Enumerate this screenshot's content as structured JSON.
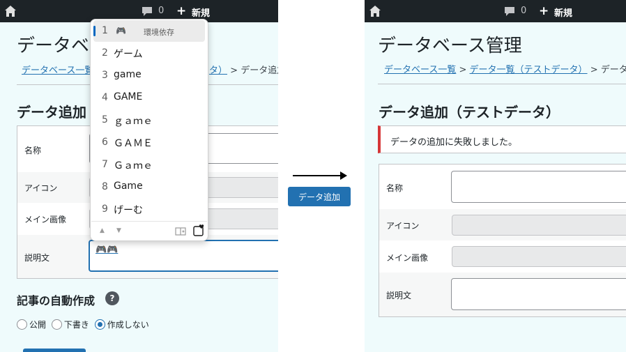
{
  "adminbar": {
    "comment_count": "0",
    "new_label": "新規"
  },
  "left": {
    "title": "データベ",
    "breadcrumb": {
      "link1": "データベース一覧",
      "link2": "タ）",
      "sep": ">",
      "current": "データ追加"
    },
    "heading": "データ追加",
    "fields": {
      "name": "名称",
      "icon": "アイコン",
      "main_image": "メイン画像",
      "description": "説明文"
    },
    "description_value": "🎮🎮",
    "auto_section": {
      "title": "記事の自動作成",
      "help": "?",
      "options": [
        "公開",
        "下書き",
        "作成しない"
      ],
      "selected": "作成しない"
    }
  },
  "ime": {
    "candidates": [
      {
        "num": "1",
        "text": "🎮",
        "annotation": "環境依存",
        "selected": true
      },
      {
        "num": "2",
        "text": "ゲーム"
      },
      {
        "num": "3",
        "text": "game"
      },
      {
        "num": "4",
        "text": "GAME"
      },
      {
        "num": "5",
        "text": "ｇａｍｅ"
      },
      {
        "num": "6",
        "text": "ＧＡＭＥ"
      },
      {
        "num": "7",
        "text": "Ｇａｍｅ"
      },
      {
        "num": "8",
        "text": "Game"
      },
      {
        "num": "9",
        "text": "げーむ"
      }
    ],
    "nav_up": "▲",
    "nav_down": "▼"
  },
  "transition": {
    "button_label": "データ追加"
  },
  "right": {
    "title": "データベース管理",
    "breadcrumb": {
      "link1": "データベース一覧",
      "sep": ">",
      "link2": "データ一覧（テストデータ）",
      "current": "データ追"
    },
    "heading": "データ追加（テストデータ）",
    "notice": "データの追加に失敗しました。",
    "fields": {
      "name": "名称",
      "icon": "アイコン",
      "main_image": "メイン画像",
      "description": "説明文"
    }
  },
  "colors": {
    "accent": "#2271b1",
    "error": "#d63638",
    "adminbar": "#1d2327",
    "page_bg": "#effbfc"
  }
}
